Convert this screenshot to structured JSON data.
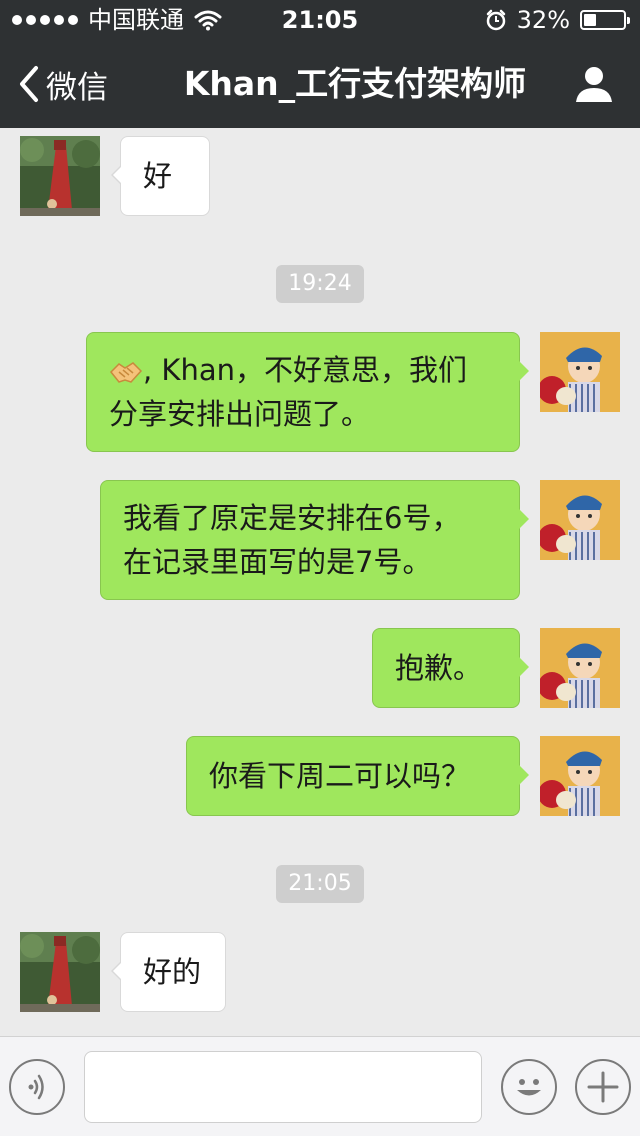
{
  "status_bar": {
    "carrier": "中国联通",
    "time": "21:05",
    "battery": "32%",
    "battery_level": 0.32
  },
  "nav": {
    "back_label": "微信",
    "title": "Khan_工行支付架构师"
  },
  "messages": [
    {
      "from": "other",
      "text": "好"
    },
    {
      "type": "timestamp",
      "text": "19:24"
    },
    {
      "from": "me",
      "emoji": "handshake-emoji",
      "text": ", Khan，不好意思，我们\n分享安排出问题了。"
    },
    {
      "from": "me",
      "text": "我看了原定是安排在6号，\n在记录里面写的是7号。"
    },
    {
      "from": "me",
      "text": "抱歉。"
    },
    {
      "from": "me",
      "text": "你看下周二可以吗？"
    },
    {
      "type": "timestamp",
      "text": "21:05"
    },
    {
      "from": "other",
      "text": "好的"
    }
  ],
  "input_bar": {
    "voice_icon": "voice-icon",
    "emoji_icon": "smiley-icon",
    "add_icon": "plus-icon",
    "message_value": ""
  },
  "colors": {
    "nav_bg": "#2e3133",
    "chat_bg": "#ebebeb",
    "outgoing_bubble": "#9fe75d",
    "incoming_bubble": "#ffffff",
    "timestamp_bg": "#cecece"
  }
}
